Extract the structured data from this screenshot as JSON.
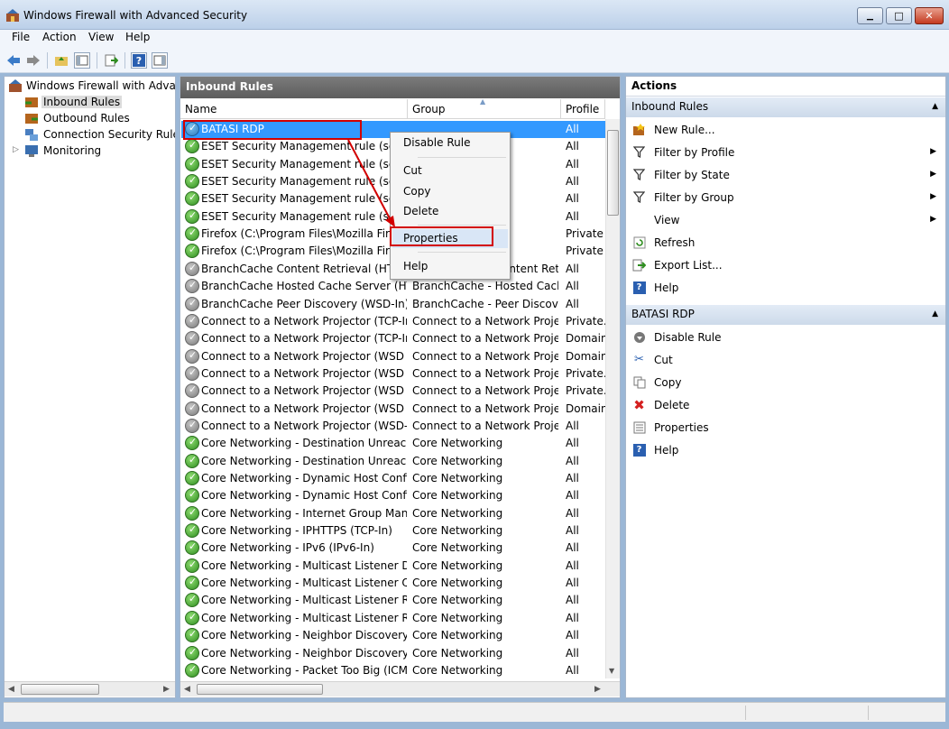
{
  "window": {
    "title": "Windows Firewall with Advanced Security",
    "minimize_glyph": "▁",
    "maximize_glyph": "□",
    "close_glyph": "✕"
  },
  "menu": [
    "File",
    "Action",
    "View",
    "Help"
  ],
  "toolbar": {
    "icons": [
      "back-icon",
      "forward-icon",
      "up-folder-icon",
      "show-hide-console-tree-icon",
      "export-list-icon",
      "help-icon",
      "show-hide-action-pane-icon"
    ]
  },
  "tree": {
    "root": "Windows Firewall with Advanced Security on Local Computer",
    "items": [
      "Inbound Rules",
      "Outbound Rules",
      "Connection Security Rules",
      "Monitoring"
    ],
    "expand_glyph": "▷"
  },
  "middle": {
    "header": "Inbound Rules",
    "columns": [
      "Name",
      "Group",
      "Profile"
    ],
    "rows": [
      {
        "name": "BATASI RDP",
        "group": "",
        "profile": "All",
        "status": "blue"
      },
      {
        "name": "ESET Security Management rule (service)",
        "group": "",
        "profile": "All",
        "status": "green"
      },
      {
        "name": "ESET Security Management rule (service)",
        "group": "",
        "profile": "All",
        "status": "green"
      },
      {
        "name": "ESET Security Management rule (service)",
        "group": "",
        "profile": "All",
        "status": "green"
      },
      {
        "name": "ESET Security Management rule (service)",
        "group": "",
        "profile": "All",
        "status": "green"
      },
      {
        "name": "ESET Security Management rule (service)",
        "group": "",
        "profile": "All",
        "status": "green"
      },
      {
        "name": "Firefox (C:\\Program Files\\Mozilla Firefox)",
        "group": "",
        "profile": "Private",
        "status": "green"
      },
      {
        "name": "Firefox (C:\\Program Files\\Mozilla Firefox)",
        "group": "",
        "profile": "Private",
        "status": "green"
      },
      {
        "name": "BranchCache Content Retrieval (HTTP-In)",
        "group": "BranchCache - Content Retr...",
        "profile": "All",
        "status": "grey"
      },
      {
        "name": "BranchCache Hosted Cache Server (HTT...",
        "group": "BranchCache - Hosted Cach...",
        "profile": "All",
        "status": "grey"
      },
      {
        "name": "BranchCache Peer Discovery (WSD-In)",
        "group": "BranchCache - Peer Discove...",
        "profile": "All",
        "status": "grey"
      },
      {
        "name": "Connect to a Network Projector (TCP-In)",
        "group": "Connect to a Network Proje...",
        "profile": "Private...",
        "status": "grey"
      },
      {
        "name": "Connect to a Network Projector (TCP-In)",
        "group": "Connect to a Network Proje...",
        "profile": "Domain",
        "status": "grey"
      },
      {
        "name": "Connect to a Network Projector (WSD Ev...",
        "group": "Connect to a Network Proje...",
        "profile": "Domain",
        "status": "grey"
      },
      {
        "name": "Connect to a Network Projector (WSD Ev...",
        "group": "Connect to a Network Proje...",
        "profile": "Private...",
        "status": "grey"
      },
      {
        "name": "Connect to a Network Projector (WSD Ev...",
        "group": "Connect to a Network Proje...",
        "profile": "Private...",
        "status": "grey"
      },
      {
        "name": "Connect to a Network Projector (WSD Ev...",
        "group": "Connect to a Network Proje...",
        "profile": "Domain",
        "status": "grey"
      },
      {
        "name": "Connect to a Network Projector (WSD-In)",
        "group": "Connect to a Network Proje...",
        "profile": "All",
        "status": "grey"
      },
      {
        "name": "Core Networking - Destination Unreacha...",
        "group": "Core Networking",
        "profile": "All",
        "status": "green"
      },
      {
        "name": "Core Networking - Destination Unreacha...",
        "group": "Core Networking",
        "profile": "All",
        "status": "green"
      },
      {
        "name": "Core Networking - Dynamic Host Config...",
        "group": "Core Networking",
        "profile": "All",
        "status": "green"
      },
      {
        "name": "Core Networking - Dynamic Host Config...",
        "group": "Core Networking",
        "profile": "All",
        "status": "green"
      },
      {
        "name": "Core Networking - Internet Group Mana...",
        "group": "Core Networking",
        "profile": "All",
        "status": "green"
      },
      {
        "name": "Core Networking - IPHTTPS (TCP-In)",
        "group": "Core Networking",
        "profile": "All",
        "status": "green"
      },
      {
        "name": "Core Networking - IPv6 (IPv6-In)",
        "group": "Core Networking",
        "profile": "All",
        "status": "green"
      },
      {
        "name": "Core Networking - Multicast Listener Do...",
        "group": "Core Networking",
        "profile": "All",
        "status": "green"
      },
      {
        "name": "Core Networking - Multicast Listener Qu...",
        "group": "Core Networking",
        "profile": "All",
        "status": "green"
      },
      {
        "name": "Core Networking - Multicast Listener Rep...",
        "group": "Core Networking",
        "profile": "All",
        "status": "green"
      },
      {
        "name": "Core Networking - Multicast Listener Rep...",
        "group": "Core Networking",
        "profile": "All",
        "status": "green"
      },
      {
        "name": "Core Networking - Neighbor Discovery A...",
        "group": "Core Networking",
        "profile": "All",
        "status": "green"
      },
      {
        "name": "Core Networking - Neighbor Discovery S...",
        "group": "Core Networking",
        "profile": "All",
        "status": "green"
      },
      {
        "name": "Core Networking - Packet Too Big (ICMP...",
        "group": "Core Networking",
        "profile": "All",
        "status": "green"
      }
    ]
  },
  "context_menu": [
    "Disable Rule",
    "Cut",
    "Copy",
    "Delete",
    "Properties",
    "Help"
  ],
  "actions": {
    "title": "Actions",
    "section1": "Inbound Rules",
    "section1_items": [
      {
        "label": "New Rule...",
        "icon": "new-rule-icon"
      },
      {
        "label": "Filter by Profile",
        "icon": "filter-icon"
      },
      {
        "label": "Filter by State",
        "icon": "filter-icon"
      },
      {
        "label": "Filter by Group",
        "icon": "filter-icon"
      },
      {
        "label": "View",
        "icon": "none"
      },
      {
        "label": "Refresh",
        "icon": "refresh-icon"
      },
      {
        "label": "Export List...",
        "icon": "export-icon"
      },
      {
        "label": "Help",
        "icon": "help-icon"
      }
    ],
    "section2": "BATASI RDP",
    "section2_items": [
      {
        "label": "Disable Rule",
        "icon": "disable-icon"
      },
      {
        "label": "Cut",
        "icon": "cut-icon"
      },
      {
        "label": "Copy",
        "icon": "copy-icon"
      },
      {
        "label": "Delete",
        "icon": "delete-icon"
      },
      {
        "label": "Properties",
        "icon": "properties-icon"
      },
      {
        "label": "Help",
        "icon": "help-icon"
      }
    ]
  },
  "colors": {
    "selection": "#3399ff",
    "highlight_box": "#d20000",
    "enabled": "#2e8d1f",
    "disabled": "#7a7a7a"
  }
}
